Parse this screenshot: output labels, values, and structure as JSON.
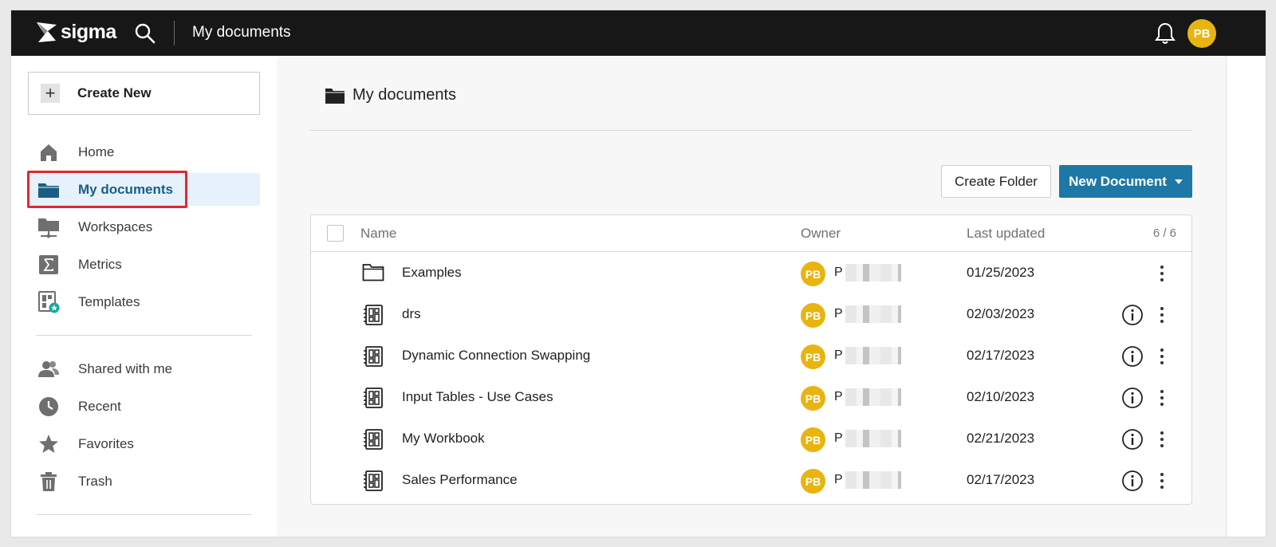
{
  "topbar": {
    "brand": "sigma",
    "title": "My documents",
    "avatar_initials": "PB"
  },
  "sidebar": {
    "create_new_label": "Create New",
    "nav_primary": [
      {
        "label": "Home",
        "icon": "home-icon",
        "active": false
      },
      {
        "label": "My documents",
        "icon": "folder-icon",
        "active": true
      },
      {
        "label": "Workspaces",
        "icon": "workspaces-icon",
        "active": false
      },
      {
        "label": "Metrics",
        "icon": "sigma-metrics-icon",
        "active": false
      },
      {
        "label": "Templates",
        "icon": "templates-icon",
        "active": false
      }
    ],
    "nav_secondary": [
      {
        "label": "Shared with me",
        "icon": "people-icon"
      },
      {
        "label": "Recent",
        "icon": "clock-icon"
      },
      {
        "label": "Favorites",
        "icon": "star-icon"
      },
      {
        "label": "Trash",
        "icon": "trash-icon"
      }
    ]
  },
  "main": {
    "folder_title": "My documents",
    "create_folder_label": "Create Folder",
    "new_document_label": "New Document",
    "table": {
      "columns": {
        "name": "Name",
        "owner": "Owner",
        "last_updated": "Last updated"
      },
      "count": "6 / 6",
      "rows": [
        {
          "name": "Examples",
          "type": "folder",
          "owner_initials": "PB",
          "owner_name": "P",
          "last_updated": "01/25/2023",
          "has_info": false
        },
        {
          "name": "drs",
          "type": "workbook",
          "owner_initials": "PB",
          "owner_name": "P",
          "last_updated": "02/03/2023",
          "has_info": true
        },
        {
          "name": "Dynamic Connection Swapping",
          "type": "workbook",
          "owner_initials": "PB",
          "owner_name": "P",
          "last_updated": "02/17/2023",
          "has_info": true
        },
        {
          "name": "Input Tables - Use Cases",
          "type": "workbook",
          "owner_initials": "PB",
          "owner_name": "P",
          "last_updated": "02/10/2023",
          "has_info": true
        },
        {
          "name": "My Workbook",
          "type": "workbook",
          "owner_initials": "PB",
          "owner_name": "P",
          "last_updated": "02/21/2023",
          "has_info": true
        },
        {
          "name": "Sales Performance",
          "type": "workbook",
          "owner_initials": "PB",
          "owner_name": "P",
          "last_updated": "02/17/2023",
          "has_info": true
        }
      ]
    }
  },
  "colors": {
    "topbar_bg": "#171717",
    "accent": "#1e78a6",
    "avatar": "#e8b40f",
    "active_nav_bg": "#e6f1fb",
    "highlight_border": "#e5262f"
  }
}
